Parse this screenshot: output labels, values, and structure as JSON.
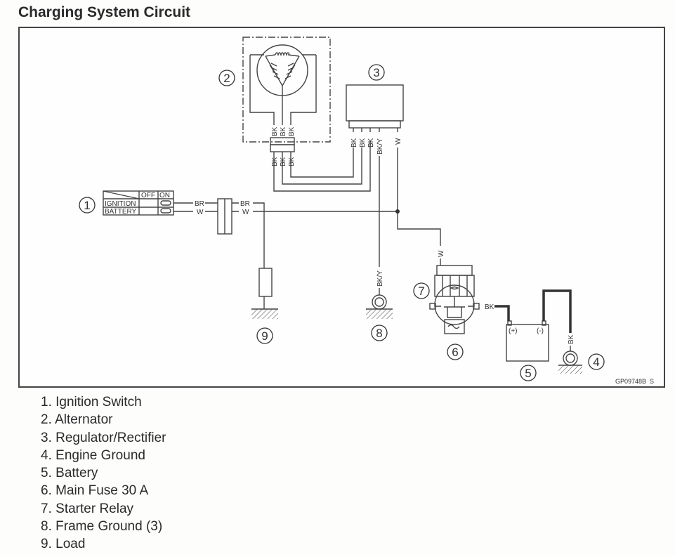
{
  "title": "Charging System Circuit",
  "figure_code": "GP09748B  S",
  "callouts": [
    "1",
    "2",
    "3",
    "4",
    "5",
    "6",
    "7",
    "8",
    "9"
  ],
  "switch": {
    "header_off": "OFF",
    "header_on": "ON",
    "row1": "IGNITION",
    "row2": "BATTERY"
  },
  "wires": {
    "br": "BR",
    "w": "W",
    "bk": "BK",
    "bky": "BK/Y"
  },
  "battery": {
    "plus": "(+)",
    "minus": "(-)"
  },
  "legend": [
    {
      "num": "1.",
      "label": "Ignition Switch"
    },
    {
      "num": "2.",
      "label": "Alternator"
    },
    {
      "num": "3.",
      "label": "Regulator/Rectifier"
    },
    {
      "num": "4.",
      "label": "Engine Ground"
    },
    {
      "num": "5.",
      "label": "Battery"
    },
    {
      "num": "6.",
      "label": "Main Fuse 30 A"
    },
    {
      "num": "7.",
      "label": "Starter Relay"
    },
    {
      "num": "8.",
      "label": "Frame Ground (3)"
    },
    {
      "num": "9.",
      "label": "Load"
    }
  ]
}
